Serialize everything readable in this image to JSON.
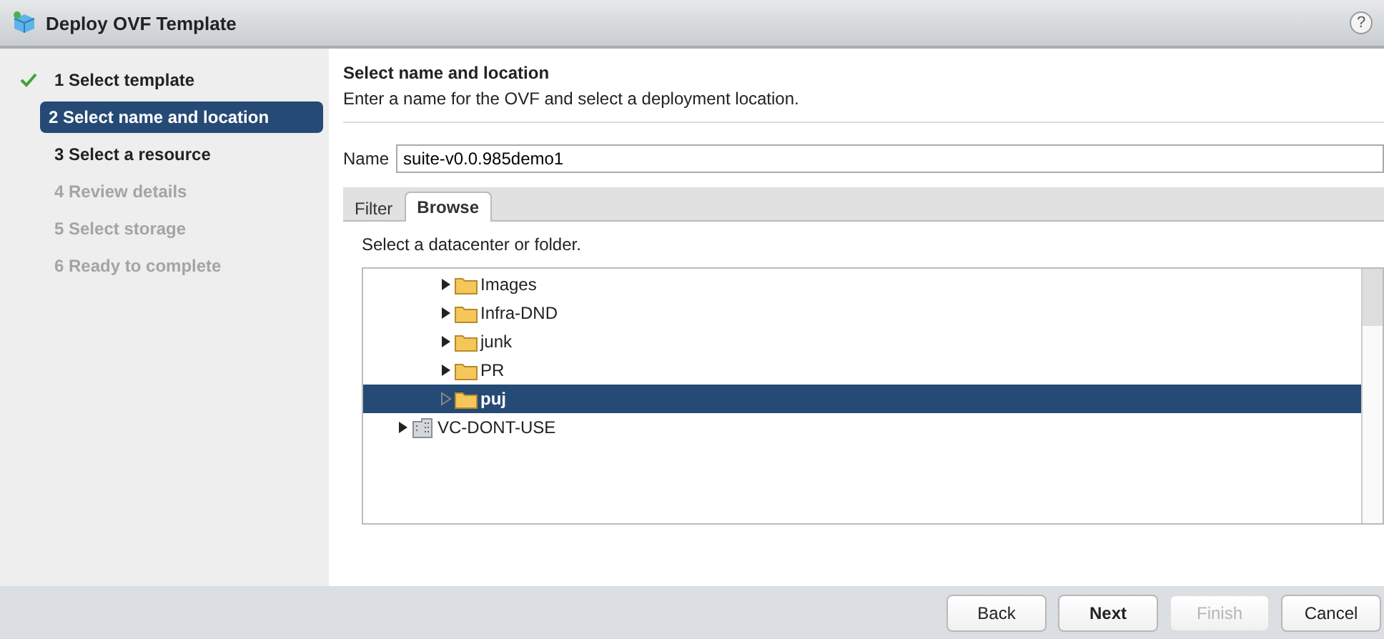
{
  "window": {
    "title": "Deploy OVF Template",
    "help": "?"
  },
  "steps": [
    {
      "label": "1 Select template",
      "checked": true,
      "selected": false,
      "disabled": false
    },
    {
      "label": "2 Select name and location",
      "checked": false,
      "selected": true,
      "disabled": false
    },
    {
      "label": "3 Select a resource",
      "checked": false,
      "selected": false,
      "disabled": false
    },
    {
      "label": "4 Review details",
      "checked": false,
      "selected": false,
      "disabled": true
    },
    {
      "label": "5 Select storage",
      "checked": false,
      "selected": false,
      "disabled": true
    },
    {
      "label": "6 Ready to complete",
      "checked": false,
      "selected": false,
      "disabled": true
    }
  ],
  "page": {
    "title": "Select name and location",
    "subtitle": "Enter a name for the OVF and select a deployment location."
  },
  "name_field": {
    "label": "Name",
    "value": "suite-v0.0.985demo1"
  },
  "tabs": [
    {
      "label": "Filter",
      "selected": false
    },
    {
      "label": "Browse",
      "selected": true
    }
  ],
  "browse": {
    "hint": "Select a datacenter or folder.",
    "tree": [
      {
        "kind": "group",
        "children": [
          {
            "kind": "folder",
            "label": "Images",
            "selected": false
          },
          {
            "kind": "folder",
            "label": "Infra-DND",
            "selected": false
          },
          {
            "kind": "folder",
            "label": "junk",
            "selected": false
          },
          {
            "kind": "folder",
            "label": "PR",
            "selected": false
          },
          {
            "kind": "folder",
            "label": "puj",
            "selected": true
          }
        ]
      },
      {
        "kind": "datacenter",
        "label": "VC-DONT-USE",
        "selected": false
      }
    ]
  },
  "buttons": [
    {
      "label": "Back",
      "primary": false,
      "disabled": false
    },
    {
      "label": "Next",
      "primary": true,
      "disabled": false
    },
    {
      "label": "Finish",
      "primary": false,
      "disabled": true
    },
    {
      "label": "Cancel",
      "primary": false,
      "disabled": false
    }
  ]
}
